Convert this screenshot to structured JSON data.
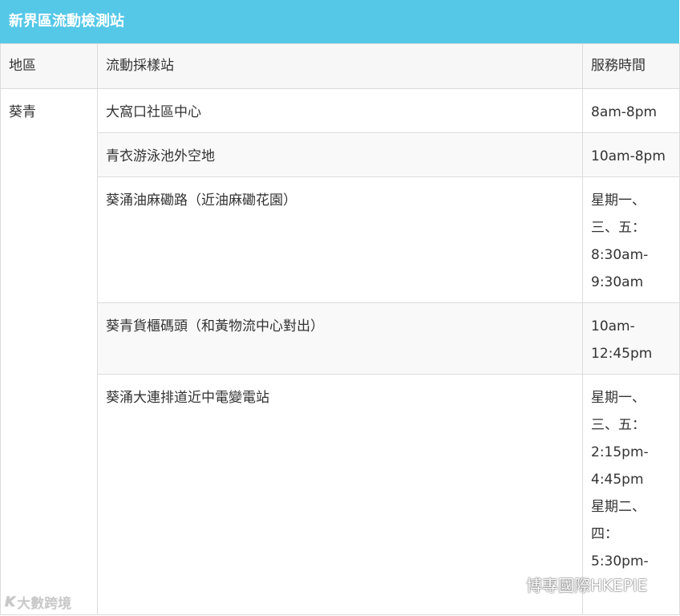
{
  "title": "新界區流動檢測站",
  "table": {
    "headers": {
      "area": "地區",
      "site": "流動採樣站",
      "hours": "服務時間"
    },
    "area_name": "葵青",
    "rows": [
      {
        "site": "大窩口社區中心",
        "hours": [
          "8am-8pm"
        ]
      },
      {
        "site": "青衣游泳池外空地",
        "hours": [
          "10am-8pm"
        ]
      },
      {
        "site": "葵涌油麻磡路（近油麻磡花園）",
        "hours": [
          "星期一、",
          "三、五：",
          "8:30am-",
          "9:30am"
        ]
      },
      {
        "site": "葵青貨櫃碼頭（和黃物流中心對出）",
        "hours": [
          "10am-",
          "12:45pm"
        ]
      },
      {
        "site": "葵涌大連排道近中電變電站",
        "hours": [
          "星期一、",
          "三、五：",
          "2:15pm-",
          "4:45pm",
          "星期二、",
          "四：",
          "5:30pm-"
        ]
      }
    ]
  },
  "watermarks": {
    "left_logo": "K",
    "left_text": "大數跨境",
    "right_text": "博專國際HKEPIE",
    "right_icon": "wechat-icon"
  },
  "colors": {
    "title_bg": "#55c8e8",
    "border": "#dcdcdc"
  }
}
